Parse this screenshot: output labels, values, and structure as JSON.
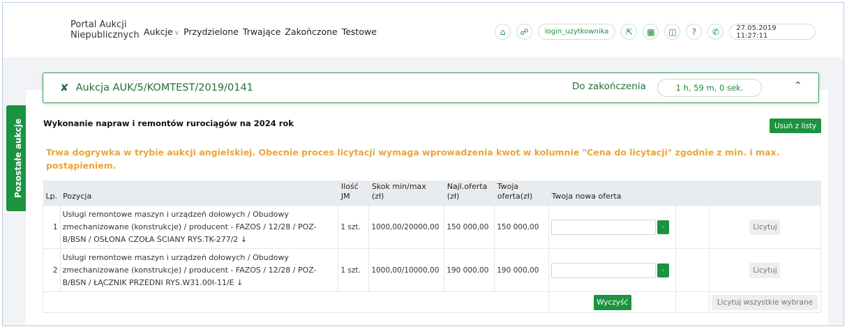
{
  "header": {
    "brand_line1": "Portal Aukcji",
    "brand_line2": "Niepublicznych",
    "nav": [
      "Aukcje",
      "Przydzielone",
      "Trwające",
      "Zakończone",
      "Testowe"
    ],
    "login": "login_uzytkownika",
    "datetime": "27.05.2019 11:27:11"
  },
  "sidetab_label": "Pozostałe aukcje",
  "auction": {
    "title": "Aukcja AUK/5/KOMTEST/2019/0141",
    "end_label": "Do zakończenia",
    "timer": "1 h, 59 m, 0 sek.",
    "subject": "Wykonanie napraw i remontów rurociągów na 2024 rok",
    "remove_label": "Usuń z listy",
    "notice": "Trwa dogrywka w trybie aukcji angielskiej. Obecnie proces licytacji wymaga wprowadzenia kwot w kolumnie \"Cena do licytacji\" zgodnie z min. i max. postąpieniem."
  },
  "table": {
    "headers": {
      "lp": "Lp.",
      "pozycja": "Pozycja",
      "ilosc": "Ilość",
      "jm": "JM",
      "skok": "Skok min/max",
      "skok_unit": "(zł)",
      "najl": "Najl.oferta",
      "najl_unit": "(zł)",
      "twoja1": "Twoja",
      "twoja2": "oferta(zł)",
      "nowa": "Twoja nowa oferta"
    },
    "rows": [
      {
        "lp": "1",
        "line1": "Usługi remontowe maszyn i urządzeń dołowych / Obudowy",
        "line2": "zmechanizowane (konstrukcje) / producent - FAZOS / 12/28 / POZ-",
        "line3": "B/BSN / OSŁONA CZOŁA ŚCIANY RYS.TK-277/2 ↓",
        "qty": "1 szt.",
        "step": "1000,00/20000,00",
        "best": "150 000,00",
        "yours": "150 000,00",
        "btn_icon": "-",
        "bid": "Licytuj"
      },
      {
        "lp": "2",
        "line1": "Usługi remontowe maszyn i urządzeń dołowych / Obudowy",
        "line2": "zmechanizowane (konstrukcje) / producent - FAZOS / 12/28 / POZ-",
        "line3": "B/BSN / ŁĄCZNIK PRZEDNI RYS.W31.00I-11/E ↓",
        "qty": "1 szt.",
        "step": "1000,00/10000,00",
        "best": "190 000,00",
        "yours": "190 000,00",
        "btn_icon": "-",
        "bid": "Licytuj"
      }
    ],
    "clear_label": "Wyczyść",
    "bid_all_label": "Licytuj wszystkie wybrane"
  },
  "colors": {
    "accent_green": "#1b9340",
    "notice_orange": "#e8a63a",
    "offer_red": "#c0576b"
  },
  "icons": [
    "home-icon",
    "link-icon",
    "exit-icon",
    "calendar-icon",
    "book-icon",
    "help-icon",
    "phone-icon",
    "gavel-icon",
    "chevron-up-icon",
    "arrow-down-icon"
  ]
}
